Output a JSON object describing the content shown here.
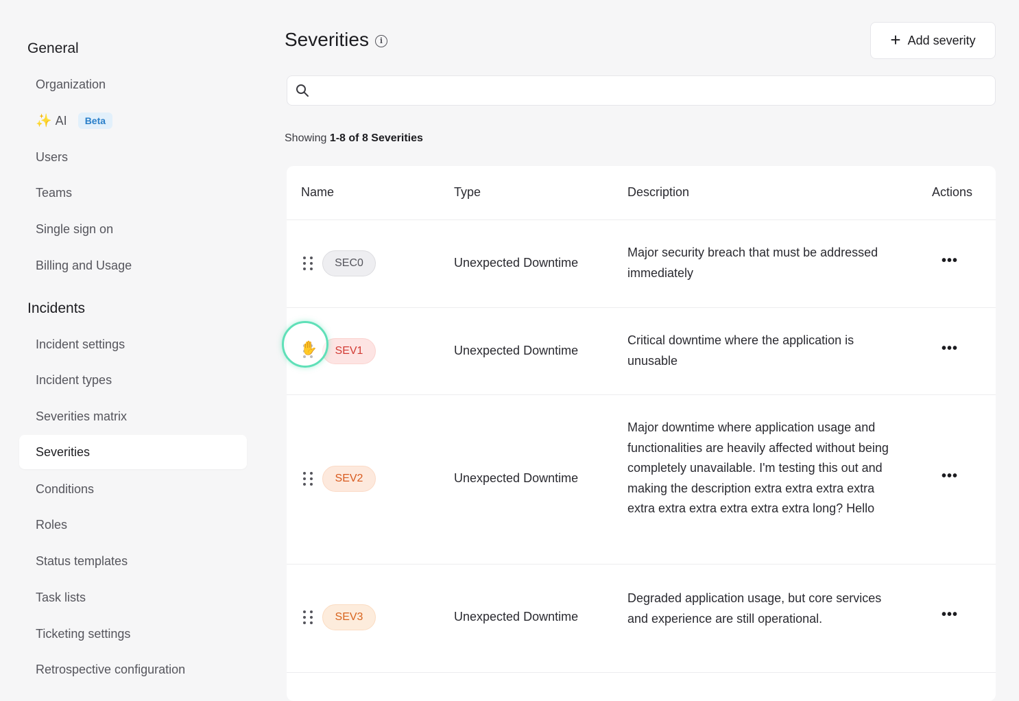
{
  "sidebar": {
    "general_title": "General",
    "general_items": [
      {
        "label": "Organization"
      },
      {
        "label": "AI",
        "badge": "Beta"
      },
      {
        "label": "Users"
      },
      {
        "label": "Teams"
      },
      {
        "label": "Single sign on"
      },
      {
        "label": "Billing and Usage"
      }
    ],
    "incidents_title": "Incidents",
    "incidents_items": [
      {
        "label": "Incident settings"
      },
      {
        "label": "Incident types"
      },
      {
        "label": "Severities matrix"
      },
      {
        "label": "Severities",
        "active": true
      },
      {
        "label": "Conditions"
      },
      {
        "label": "Roles"
      },
      {
        "label": "Status templates"
      },
      {
        "label": "Task lists"
      },
      {
        "label": "Ticketing settings"
      },
      {
        "label": "Retrospective configuration"
      }
    ]
  },
  "header": {
    "title": "Severities",
    "add_label": "Add severity"
  },
  "search": {
    "value": "",
    "placeholder": ""
  },
  "summary": {
    "prefix": "Showing",
    "range": "1-8 of 8 Severities"
  },
  "table": {
    "columns": {
      "name": "Name",
      "type": "Type",
      "description": "Description",
      "actions": "Actions"
    },
    "rows": [
      {
        "name": "SEC0",
        "type": "Unexpected Downtime",
        "description": "Major security breach that must be addressed immediately",
        "badge_bg": "#eeeef1",
        "badge_fg": "#55555c",
        "badge_border": "#dcdce0"
      },
      {
        "name": "SEV1",
        "type": "Unexpected Downtime",
        "description": "Critical downtime where the application is unusable",
        "badge_bg": "#fde4e3",
        "badge_fg": "#d23a33",
        "badge_border": "#fbd3d0"
      },
      {
        "name": "SEV2",
        "type": "Unexpected Downtime",
        "description": "Major downtime where application usage and functionalities are heavily affected without being completely unavailable. I'm testing this out and making the description extra extra extra extra extra extra extra extra extra extra long? Hello",
        "badge_bg": "#fde9dd",
        "badge_fg": "#d85a1e",
        "badge_border": "#fbdac6"
      },
      {
        "name": "SEV3",
        "type": "Unexpected Downtime",
        "description": "Degraded application usage, but core services and experience are still operational.",
        "badge_bg": "#fdecdc",
        "badge_fg": "#d8641e",
        "badge_border": "#fbdcc2"
      }
    ]
  },
  "colors": {
    "accent": "#5fe0b8",
    "beta_bg": "#e2f0fb",
    "beta_fg": "#2a7fc9"
  }
}
